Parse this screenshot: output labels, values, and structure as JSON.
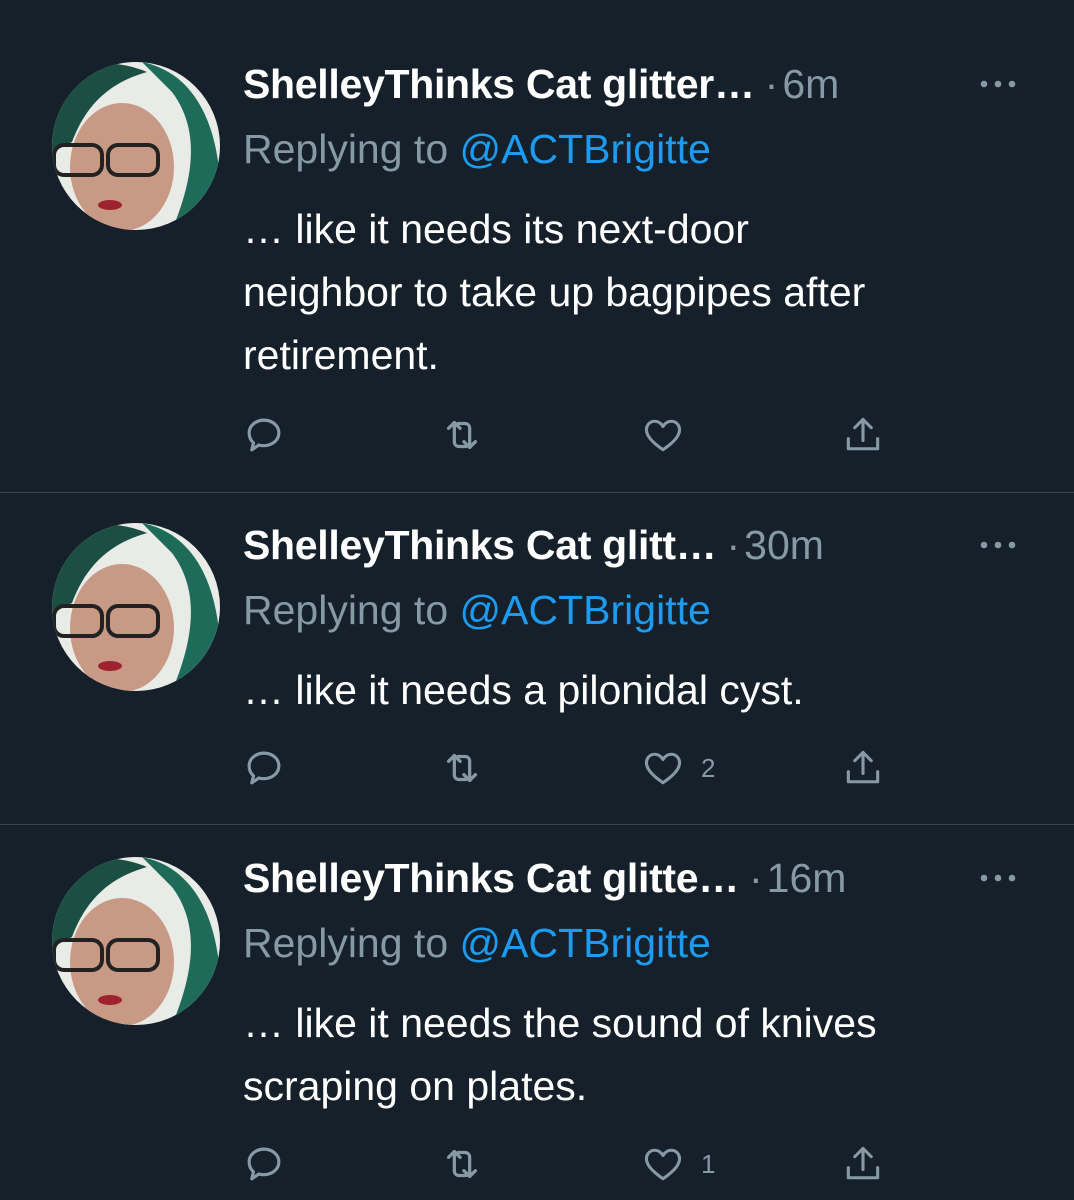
{
  "tweets": [
    {
      "display_name": "ShelleyThinks Cat glitter…",
      "separator": "·",
      "time": "6m",
      "replying_prefix": "Replying to",
      "replying_handle": "@ACTBrigitte",
      "text_lines": [
        "… like it needs its next-door",
        "neighbor to take up bagpipes after",
        "retirement."
      ],
      "like_count": ""
    },
    {
      "display_name": "ShelleyThinks Cat glitt…",
      "separator": "·",
      "time": "30m",
      "replying_prefix": "Replying to",
      "replying_handle": "@ACTBrigitte",
      "text_lines": [
        "… like it needs a pilonidal cyst."
      ],
      "like_count": "2"
    },
    {
      "display_name": "ShelleyThinks Cat glitte…",
      "separator": "·",
      "time": "16m",
      "replying_prefix": "Replying to",
      "replying_handle": "@ACTBrigitte",
      "text_lines": [
        "… like it needs the sound of knives",
        "scraping on plates."
      ],
      "like_count": "1"
    }
  ],
  "icons": {
    "reply": "reply-icon",
    "retweet": "retweet-icon",
    "like": "heart-icon",
    "share": "share-icon",
    "more": "more-icon"
  },
  "colors": {
    "background": "#15202b",
    "text": "#ffffff",
    "muted": "#8899a6",
    "link": "#1d9bf0",
    "divider": "#38444d"
  }
}
